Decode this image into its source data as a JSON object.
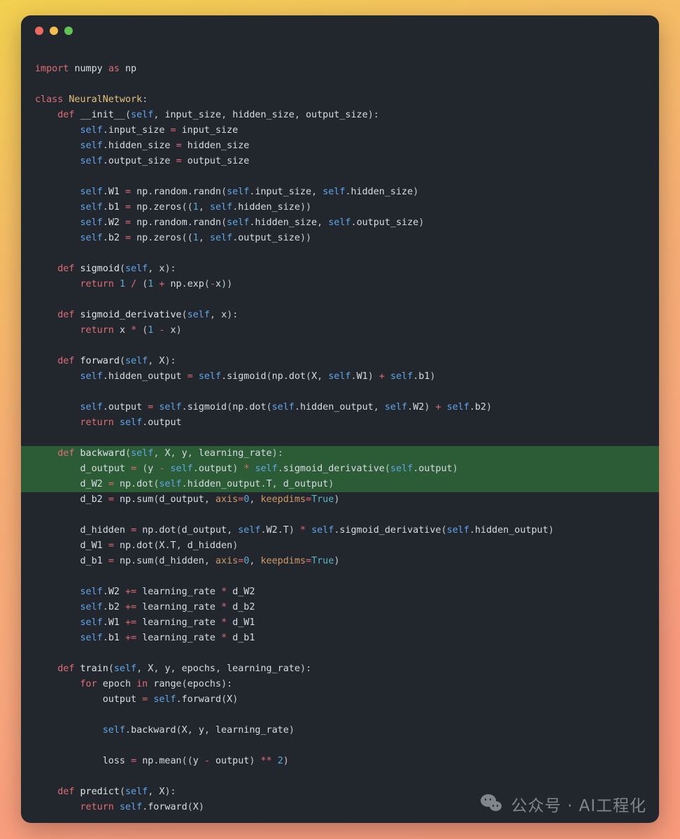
{
  "window": {
    "title": "",
    "traffic_lights": [
      {
        "name": "close-button",
        "color": "#ec6a5f"
      },
      {
        "name": "minimize-button",
        "color": "#f3bf4f"
      },
      {
        "name": "maximize-button",
        "color": "#61c354"
      }
    ],
    "background_gradient": {
      "from": "#f2d04f",
      "to": "#f89a7b"
    },
    "card_background": "#22272e",
    "highlight_color": "#2b5c35"
  },
  "watermark": {
    "icon": "wechat-icon",
    "text": "公众号 · AI工程化"
  },
  "code": {
    "language": "python",
    "highlighted_lines": [
      26,
      27,
      28
    ],
    "lines": [
      "",
      "import numpy as np",
      "",
      "class NeuralNetwork:",
      "    def __init__(self, input_size, hidden_size, output_size):",
      "        self.input_size = input_size",
      "        self.hidden_size = hidden_size",
      "        self.output_size = output_size",
      "",
      "        self.W1 = np.random.randn(self.input_size, self.hidden_size)",
      "        self.b1 = np.zeros((1, self.hidden_size))",
      "        self.W2 = np.random.randn(self.hidden_size, self.output_size)",
      "        self.b2 = np.zeros((1, self.output_size))",
      "",
      "    def sigmoid(self, x):",
      "        return 1 / (1 + np.exp(-x))",
      "",
      "    def sigmoid_derivative(self, x):",
      "        return x * (1 - x)",
      "",
      "    def forward(self, X):",
      "        self.hidden_output = self.sigmoid(np.dot(X, self.W1) + self.b1)",
      "",
      "        self.output = self.sigmoid(np.dot(self.hidden_output, self.W2) + self.b2)",
      "        return self.output",
      "",
      "    def backward(self, X, y, learning_rate):",
      "        d_output = (y - self.output) * self.sigmoid_derivative(self.output)",
      "        d_W2 = np.dot(self.hidden_output.T, d_output)",
      "        d_b2 = np.sum(d_output, axis=0, keepdims=True)",
      "",
      "        d_hidden = np.dot(d_output, self.W2.T) * self.sigmoid_derivative(self.hidden_output)",
      "        d_W1 = np.dot(X.T, d_hidden)",
      "        d_b1 = np.sum(d_hidden, axis=0, keepdims=True)",
      "",
      "        self.W2 += learning_rate * d_W2",
      "        self.b2 += learning_rate * d_b2",
      "        self.W1 += learning_rate * d_W1",
      "        self.b1 += learning_rate * d_b1",
      "",
      "    def train(self, X, y, epochs, learning_rate):",
      "        for epoch in range(epochs):",
      "            output = self.forward(X)",
      "",
      "            self.backward(X, y, learning_rate)",
      "",
      "            loss = np.mean((y - output) ** 2)",
      "",
      "    def predict(self, X):",
      "        return self.forward(X)"
    ]
  }
}
